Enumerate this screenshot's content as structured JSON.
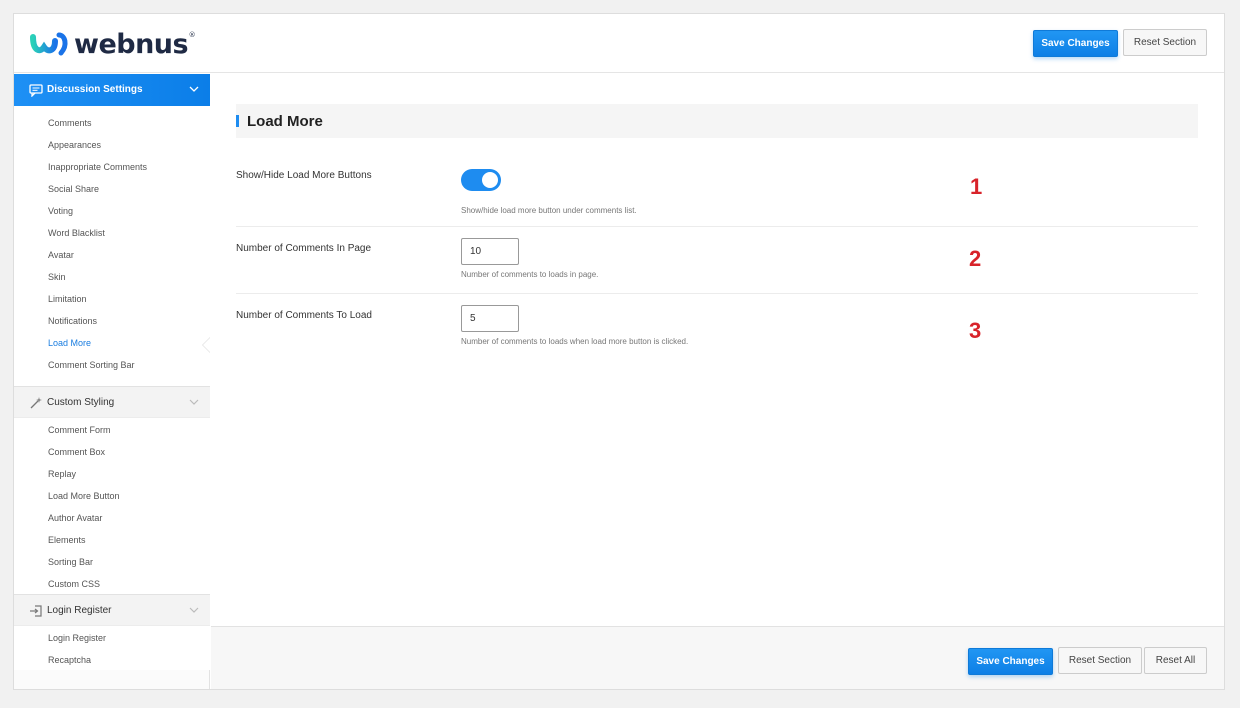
{
  "header": {
    "logo_text": "webnus",
    "logo_mark": "®",
    "save_label": "Save Changes",
    "reset_section_label": "Reset Section"
  },
  "sidebar": {
    "groups": [
      {
        "label": "Discussion Settings",
        "icon": "comment-icon",
        "active": true,
        "items": [
          {
            "label": "Comments"
          },
          {
            "label": "Appearances"
          },
          {
            "label": "Inappropriate Comments"
          },
          {
            "label": "Social Share"
          },
          {
            "label": "Voting"
          },
          {
            "label": "Word Blacklist"
          },
          {
            "label": "Avatar"
          },
          {
            "label": "Skin"
          },
          {
            "label": "Limitation"
          },
          {
            "label": "Notifications"
          },
          {
            "label": "Load More"
          },
          {
            "label": "Comment Sorting Bar"
          }
        ]
      },
      {
        "label": "Custom Styling",
        "icon": "wand-icon",
        "active": false,
        "items": [
          {
            "label": "Comment Form"
          },
          {
            "label": "Comment Box"
          },
          {
            "label": "Replay"
          },
          {
            "label": "Load More Button"
          },
          {
            "label": "Author Avatar"
          },
          {
            "label": "Elements"
          },
          {
            "label": "Sorting Bar"
          },
          {
            "label": "Custom CSS"
          }
        ]
      },
      {
        "label": "Login Register",
        "icon": "login-icon",
        "active": false,
        "items": [
          {
            "label": "Login Register"
          },
          {
            "label": "Recaptcha"
          }
        ]
      }
    ],
    "current_item": "Load More"
  },
  "main": {
    "section_title": "Load More",
    "rows": [
      {
        "label": "Show/Hide Load More Buttons",
        "type": "toggle",
        "value": true,
        "description": "Show/hide load more button under comments list.",
        "annotation": "1"
      },
      {
        "label": "Number of Comments In Page",
        "type": "number",
        "value": "10",
        "description": "Number of comments to loads in page.",
        "annotation": "2"
      },
      {
        "label": "Number of Comments To Load",
        "type": "number",
        "value": "5",
        "description": "Number of comments to loads when load more button is clicked.",
        "annotation": "3"
      }
    ]
  },
  "footer": {
    "save_label": "Save Changes",
    "reset_section_label": "Reset Section",
    "reset_all_label": "Reset All"
  },
  "colors": {
    "accent": "#1e8cf0",
    "annotation": "#d8232a",
    "background": "#f1f1f1"
  }
}
